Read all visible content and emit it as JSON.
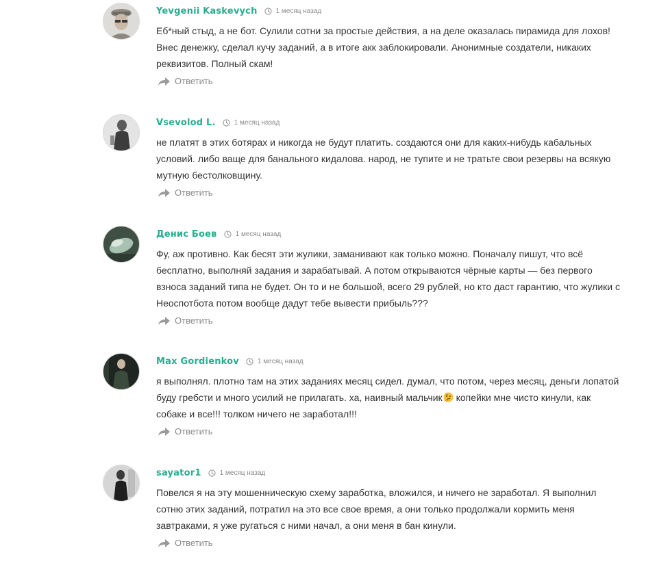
{
  "comments": [
    {
      "author": "Yevgenii Kaskevych",
      "time": "1 месяц назад",
      "text": "Еб*ный стыд, а не бот. Сулили сотни за простые действия, а на деле оказалась пирамида для лохов! Внес денежку, сделал кучу заданий, а в итоге акк заблокировали. Анонимные создатели, никаких реквизитов. Полный скам!",
      "reply_label": "Ответить"
    },
    {
      "author": "Vsevolod L.",
      "time": "1 месяц назад",
      "text": "не платят в этих ботярах и никогда не будут платить. создаются они для каких-нибудь кабальных условий. либо ваще для банального кидалова. народ, не тупите и не тратьте свои резервы на всякую мутную бестолковщину.",
      "reply_label": "Ответить"
    },
    {
      "author": "Денис Боев",
      "time": "1 месяц назад",
      "text": "Фу, аж противно. Как бесят эти жулики, заманивают как только можно. Поначалу пишут, что всё бесплатно, выполняй задания и зарабатывай. А потом открываются чёрные карты — без первого взноса заданий типа не будет. Он то и не большой, всего 29 рублей, но кто даст гарантию, что жулики с Неоспотбота потом вообще дадут тебе вывести прибыль???",
      "reply_label": "Ответить"
    },
    {
      "author": "Max Gordienkov",
      "time": "1 месяц назад",
      "text_before_emoji": "я выполнял. плотно там на этих заданиях месяц сидел. думал, что потом, через месяц, деньги лопатой буду гребсти и много усилий не прилагать. ха, наивный мальчик",
      "emoji": "thinking-face-emoji",
      "text_after_emoji": " копейки мне чисто кинули, как собаке и все!!! толком ничего не заработал!!!",
      "reply_label": "Ответить"
    },
    {
      "author": "sayator1",
      "time": "1 месяц назад",
      "text": "Повелся я на эту мошенническую схему заработка, вложился, и ничего не заработал. Я выполнил сотню этих заданий, потратил на это все свое время, а они только продолжали кормить меня завтраками, я уже ругаться с ними начал, а они меня в бан кинули.",
      "reply_label": "Ответить"
    }
  ],
  "icons": {
    "time": "clock-icon",
    "reply": "reply-arrow-icon"
  },
  "colors": {
    "author": "#27ae8f",
    "meta": "#888888",
    "text": "#333333"
  }
}
